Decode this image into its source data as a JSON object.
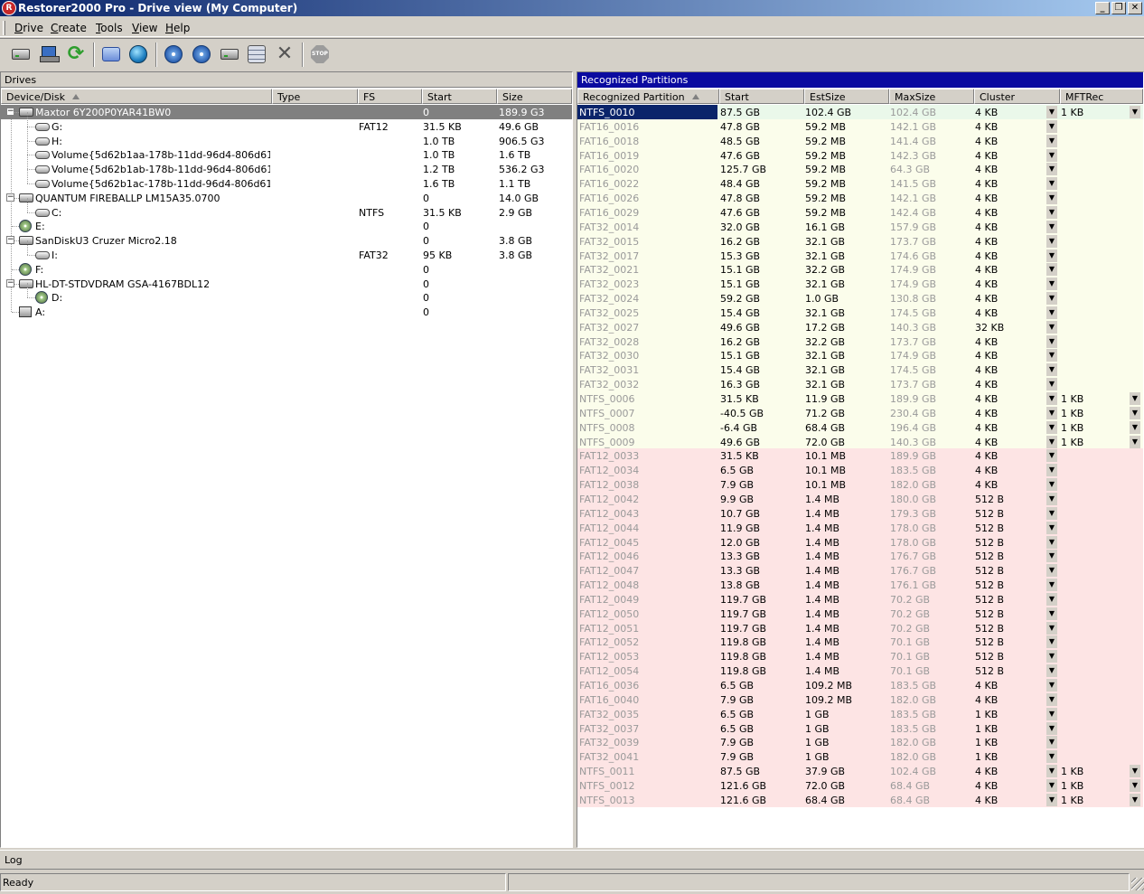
{
  "window": {
    "title": "Restorer2000 Pro - Drive view (My Computer)",
    "app_icon": "R"
  },
  "menu": [
    {
      "u": "D",
      "rest": "rive"
    },
    {
      "u": "C",
      "rest": "reate"
    },
    {
      "u": "T",
      "rest": "ools"
    },
    {
      "u": "V",
      "rest": "iew"
    },
    {
      "u": "H",
      "rest": "elp"
    }
  ],
  "toolbar": {
    "icons": [
      "local-drive-icon",
      "network-drive-icon",
      "refresh-icon",
      "window-icon",
      "globe-icon",
      "disk-open-icon",
      "disk-scan-icon",
      "disk-image-icon",
      "stack-icon",
      "delete-icon",
      "stop-icon"
    ],
    "stop_label": "STOP"
  },
  "drives": {
    "title": "Drives",
    "columns": [
      "Device/Disk",
      "Type",
      "FS",
      "Start",
      "Size"
    ],
    "rows": [
      {
        "level": 0,
        "icon": "hd",
        "expand": "-",
        "name": "Maxtor 6Y200P0YAR41BW0",
        "type": "",
        "fs": "",
        "start": "0",
        "size": "189.9 G3",
        "selected": true
      },
      {
        "level": 1,
        "icon": "vol",
        "name": "G:",
        "type": "",
        "fs": "FAT12",
        "start": "31.5 KB",
        "size": "49.6 GB"
      },
      {
        "level": 1,
        "icon": "vol",
        "name": "H:",
        "type": "",
        "fs": "",
        "start": "1.0 TB",
        "size": "906.5 G3"
      },
      {
        "level": 1,
        "icon": "vol",
        "name": "Volume{5d62b1aa-178b-11dd-96d4-806d61726…",
        "type": "",
        "fs": "",
        "start": "1.0 TB",
        "size": "1.6 TB"
      },
      {
        "level": 1,
        "icon": "vol",
        "name": "Volume{5d62b1ab-178b-11dd-96d4-806d61726…",
        "type": "",
        "fs": "",
        "start": "1.2 TB",
        "size": "536.2 G3"
      },
      {
        "level": 1,
        "icon": "vol",
        "name": "Volume{5d62b1ac-178b-11dd-96d4-806d61726…",
        "type": "",
        "fs": "",
        "start": "1.6 TB",
        "size": "1.1 TB"
      },
      {
        "level": 0,
        "icon": "hd",
        "expand": "-",
        "name": "QUANTUM FIREBALLP LM15A35.0700",
        "type": "",
        "fs": "",
        "start": "0",
        "size": "14.0 GB"
      },
      {
        "level": 1,
        "icon": "vol",
        "name": "C:",
        "type": "",
        "fs": "NTFS",
        "start": "31.5 KB",
        "size": "2.9 GB"
      },
      {
        "level": 0,
        "icon": "cd",
        "name": "E:",
        "type": "",
        "fs": "",
        "start": "0",
        "size": ""
      },
      {
        "level": 0,
        "icon": "hd",
        "expand": "-",
        "name": "SanDiskU3 Cruzer Micro2.18",
        "type": "",
        "fs": "",
        "start": "0",
        "size": "3.8 GB"
      },
      {
        "level": 1,
        "icon": "vol",
        "name": "I:",
        "type": "",
        "fs": "FAT32",
        "start": "95 KB",
        "size": "3.8 GB"
      },
      {
        "level": 0,
        "icon": "cd",
        "name": "F:",
        "type": "",
        "fs": "",
        "start": "0",
        "size": ""
      },
      {
        "level": 0,
        "icon": "hd",
        "expand": "-",
        "name": "HL-DT-STDVDRAM GSA-4167BDL12",
        "type": "",
        "fs": "",
        "start": "0",
        "size": ""
      },
      {
        "level": 1,
        "icon": "cd",
        "name": "D:",
        "type": "",
        "fs": "",
        "start": "0",
        "size": ""
      },
      {
        "level": 0,
        "icon": "fl",
        "name": "A:",
        "type": "",
        "fs": "",
        "start": "0",
        "size": ""
      }
    ]
  },
  "partitions": {
    "title": "Recognized Partitions",
    "columns": [
      "Recognized Partition",
      "Start",
      "EstSize",
      "MaxSize",
      "Cluster",
      "MFTRec"
    ],
    "rows": [
      {
        "name": "NTFS_0010",
        "start": "87.5 GB",
        "est": "102.4 GB",
        "max": "102.4 GB",
        "cluster": "4 KB",
        "mft": "1 KB",
        "group": "first",
        "selected": true
      },
      {
        "name": "FAT16_0016",
        "start": "47.8 GB",
        "est": "59.2 MB",
        "max": "142.1 GB",
        "cluster": "4 KB",
        "mft": "",
        "group": "green"
      },
      {
        "name": "FAT16_0018",
        "start": "48.5 GB",
        "est": "59.2 MB",
        "max": "141.4 GB",
        "cluster": "4 KB",
        "mft": "",
        "group": "green"
      },
      {
        "name": "FAT16_0019",
        "start": "47.6 GB",
        "est": "59.2 MB",
        "max": "142.3 GB",
        "cluster": "4 KB",
        "mft": "",
        "group": "green"
      },
      {
        "name": "FAT16_0020",
        "start": "125.7 GB",
        "est": "59.2 MB",
        "max": "64.3 GB",
        "cluster": "4 KB",
        "mft": "",
        "group": "green"
      },
      {
        "name": "FAT16_0022",
        "start": "48.4 GB",
        "est": "59.2 MB",
        "max": "141.5 GB",
        "cluster": "4 KB",
        "mft": "",
        "group": "green"
      },
      {
        "name": "FAT16_0026",
        "start": "47.8 GB",
        "est": "59.2 MB",
        "max": "142.1 GB",
        "cluster": "4 KB",
        "mft": "",
        "group": "green"
      },
      {
        "name": "FAT16_0029",
        "start": "47.6 GB",
        "est": "59.2 MB",
        "max": "142.4 GB",
        "cluster": "4 KB",
        "mft": "",
        "group": "green"
      },
      {
        "name": "FAT32_0014",
        "start": "32.0 GB",
        "est": "16.1 GB",
        "max": "157.9 GB",
        "cluster": "4 KB",
        "mft": "",
        "group": "green"
      },
      {
        "name": "FAT32_0015",
        "start": "16.2 GB",
        "est": "32.1 GB",
        "max": "173.7 GB",
        "cluster": "4 KB",
        "mft": "",
        "group": "green"
      },
      {
        "name": "FAT32_0017",
        "start": "15.3 GB",
        "est": "32.1 GB",
        "max": "174.6 GB",
        "cluster": "4 KB",
        "mft": "",
        "group": "green"
      },
      {
        "name": "FAT32_0021",
        "start": "15.1 GB",
        "est": "32.2 GB",
        "max": "174.9 GB",
        "cluster": "4 KB",
        "mft": "",
        "group": "green"
      },
      {
        "name": "FAT32_0023",
        "start": "15.1 GB",
        "est": "32.1 GB",
        "max": "174.9 GB",
        "cluster": "4 KB",
        "mft": "",
        "group": "green"
      },
      {
        "name": "FAT32_0024",
        "start": "59.2 GB",
        "est": "1.0 GB",
        "max": "130.8 GB",
        "cluster": "4 KB",
        "mft": "",
        "group": "green"
      },
      {
        "name": "FAT32_0025",
        "start": "15.4 GB",
        "est": "32.1 GB",
        "max": "174.5 GB",
        "cluster": "4 KB",
        "mft": "",
        "group": "green"
      },
      {
        "name": "FAT32_0027",
        "start": "49.6 GB",
        "est": "17.2 GB",
        "max": "140.3 GB",
        "cluster": "32 KB",
        "mft": "",
        "group": "green"
      },
      {
        "name": "FAT32_0028",
        "start": "16.2 GB",
        "est": "32.2 GB",
        "max": "173.7 GB",
        "cluster": "4 KB",
        "mft": "",
        "group": "green"
      },
      {
        "name": "FAT32_0030",
        "start": "15.1 GB",
        "est": "32.1 GB",
        "max": "174.9 GB",
        "cluster": "4 KB",
        "mft": "",
        "group": "green"
      },
      {
        "name": "FAT32_0031",
        "start": "15.4 GB",
        "est": "32.1 GB",
        "max": "174.5 GB",
        "cluster": "4 KB",
        "mft": "",
        "group": "green"
      },
      {
        "name": "FAT32_0032",
        "start": "16.3 GB",
        "est": "32.1 GB",
        "max": "173.7 GB",
        "cluster": "4 KB",
        "mft": "",
        "group": "green"
      },
      {
        "name": "NTFS_0006",
        "start": "31.5 KB",
        "est": "11.9 GB",
        "max": "189.9 GB",
        "cluster": "4 KB",
        "mft": "1 KB",
        "group": "green"
      },
      {
        "name": "NTFS_0007",
        "start": "-40.5 GB",
        "est": "71.2 GB",
        "max": "230.4 GB",
        "cluster": "4 KB",
        "mft": "1 KB",
        "group": "green"
      },
      {
        "name": "NTFS_0008",
        "start": "-6.4 GB",
        "est": "68.4 GB",
        "max": "196.4 GB",
        "cluster": "4 KB",
        "mft": "1 KB",
        "group": "green"
      },
      {
        "name": "NTFS_0009",
        "start": "49.6 GB",
        "est": "72.0 GB",
        "max": "140.3 GB",
        "cluster": "4 KB",
        "mft": "1 KB",
        "group": "green"
      },
      {
        "name": "FAT12_0033",
        "start": "31.5 KB",
        "est": "10.1 MB",
        "max": "189.9 GB",
        "cluster": "4 KB",
        "mft": "",
        "group": "pink"
      },
      {
        "name": "FAT12_0034",
        "start": "6.5 GB",
        "est": "10.1 MB",
        "max": "183.5 GB",
        "cluster": "4 KB",
        "mft": "",
        "group": "pink"
      },
      {
        "name": "FAT12_0038",
        "start": "7.9 GB",
        "est": "10.1 MB",
        "max": "182.0 GB",
        "cluster": "4 KB",
        "mft": "",
        "group": "pink"
      },
      {
        "name": "FAT12_0042",
        "start": "9.9 GB",
        "est": "1.4 MB",
        "max": "180.0 GB",
        "cluster": "512 B",
        "mft": "",
        "group": "pink"
      },
      {
        "name": "FAT12_0043",
        "start": "10.7 GB",
        "est": "1.4 MB",
        "max": "179.3 GB",
        "cluster": "512 B",
        "mft": "",
        "group": "pink"
      },
      {
        "name": "FAT12_0044",
        "start": "11.9 GB",
        "est": "1.4 MB",
        "max": "178.0 GB",
        "cluster": "512 B",
        "mft": "",
        "group": "pink"
      },
      {
        "name": "FAT12_0045",
        "start": "12.0 GB",
        "est": "1.4 MB",
        "max": "178.0 GB",
        "cluster": "512 B",
        "mft": "",
        "group": "pink"
      },
      {
        "name": "FAT12_0046",
        "start": "13.3 GB",
        "est": "1.4 MB",
        "max": "176.7 GB",
        "cluster": "512 B",
        "mft": "",
        "group": "pink"
      },
      {
        "name": "FAT12_0047",
        "start": "13.3 GB",
        "est": "1.4 MB",
        "max": "176.7 GB",
        "cluster": "512 B",
        "mft": "",
        "group": "pink"
      },
      {
        "name": "FAT12_0048",
        "start": "13.8 GB",
        "est": "1.4 MB",
        "max": "176.1 GB",
        "cluster": "512 B",
        "mft": "",
        "group": "pink"
      },
      {
        "name": "FAT12_0049",
        "start": "119.7 GB",
        "est": "1.4 MB",
        "max": "70.2 GB",
        "cluster": "512 B",
        "mft": "",
        "group": "pink"
      },
      {
        "name": "FAT12_0050",
        "start": "119.7 GB",
        "est": "1.4 MB",
        "max": "70.2 GB",
        "cluster": "512 B",
        "mft": "",
        "group": "pink"
      },
      {
        "name": "FAT12_0051",
        "start": "119.7 GB",
        "est": "1.4 MB",
        "max": "70.2 GB",
        "cluster": "512 B",
        "mft": "",
        "group": "pink"
      },
      {
        "name": "FAT12_0052",
        "start": "119.8 GB",
        "est": "1.4 MB",
        "max": "70.1 GB",
        "cluster": "512 B",
        "mft": "",
        "group": "pink"
      },
      {
        "name": "FAT12_0053",
        "start": "119.8 GB",
        "est": "1.4 MB",
        "max": "70.1 GB",
        "cluster": "512 B",
        "mft": "",
        "group": "pink"
      },
      {
        "name": "FAT12_0054",
        "start": "119.8 GB",
        "est": "1.4 MB",
        "max": "70.1 GB",
        "cluster": "512 B",
        "mft": "",
        "group": "pink"
      },
      {
        "name": "FAT16_0036",
        "start": "6.5 GB",
        "est": "109.2 MB",
        "max": "183.5 GB",
        "cluster": "4 KB",
        "mft": "",
        "group": "pink"
      },
      {
        "name": "FAT16_0040",
        "start": "7.9 GB",
        "est": "109.2 MB",
        "max": "182.0 GB",
        "cluster": "4 KB",
        "mft": "",
        "group": "pink"
      },
      {
        "name": "FAT32_0035",
        "start": "6.5 GB",
        "est": "1 GB",
        "max": "183.5 GB",
        "cluster": "1 KB",
        "mft": "",
        "group": "pink"
      },
      {
        "name": "FAT32_0037",
        "start": "6.5 GB",
        "est": "1 GB",
        "max": "183.5 GB",
        "cluster": "1 KB",
        "mft": "",
        "group": "pink"
      },
      {
        "name": "FAT32_0039",
        "start": "7.9 GB",
        "est": "1 GB",
        "max": "182.0 GB",
        "cluster": "1 KB",
        "mft": "",
        "group": "pink"
      },
      {
        "name": "FAT32_0041",
        "start": "7.9 GB",
        "est": "1 GB",
        "max": "182.0 GB",
        "cluster": "1 KB",
        "mft": "",
        "group": "pink"
      },
      {
        "name": "NTFS_0011",
        "start": "87.5 GB",
        "est": "37.9 GB",
        "max": "102.4 GB",
        "cluster": "4 KB",
        "mft": "1 KB",
        "group": "pink"
      },
      {
        "name": "NTFS_0012",
        "start": "121.6 GB",
        "est": "72.0 GB",
        "max": "68.4 GB",
        "cluster": "4 KB",
        "mft": "1 KB",
        "group": "pink"
      },
      {
        "name": "NTFS_0013",
        "start": "121.6 GB",
        "est": "68.4 GB",
        "max": "68.4 GB",
        "cluster": "4 KB",
        "mft": "1 KB",
        "group": "pink"
      }
    ]
  },
  "log": {
    "label": "Log"
  },
  "status": {
    "text": "Ready"
  },
  "colors": {
    "title_start": "#0a246a",
    "title_end": "#a6caf0",
    "partitions_header": "#0a0aa0",
    "row_green": "#fbfdeb",
    "row_pink": "#fde4e4",
    "selection": "#0a246a"
  }
}
